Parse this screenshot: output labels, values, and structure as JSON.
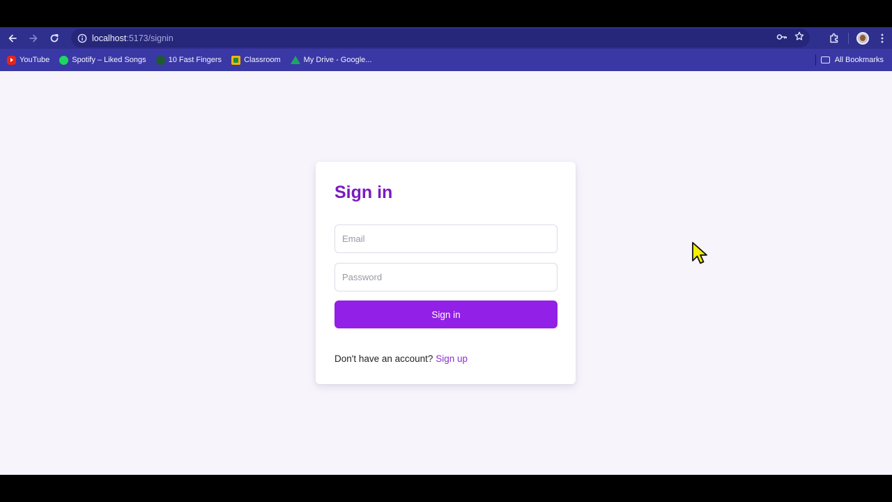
{
  "browser": {
    "url_host": "localhost",
    "url_path": ":5173/signin",
    "bookmarks": [
      {
        "label": "YouTube",
        "icon": "youtube-icon"
      },
      {
        "label": "Spotify – Liked Songs",
        "icon": "spotify-icon"
      },
      {
        "label": "10 Fast Fingers",
        "icon": "10-fast-fingers-icon"
      },
      {
        "label": "Classroom",
        "icon": "classroom-icon"
      },
      {
        "label": "My Drive - Google...",
        "icon": "google-drive-icon"
      }
    ],
    "all_bookmarks_label": "All Bookmarks"
  },
  "signin": {
    "title": "Sign in",
    "email_placeholder": "Email",
    "password_placeholder": "Password",
    "submit_label": "Sign in",
    "signup_prompt": "Don't have an account?",
    "signup_link": "Sign up"
  },
  "colors": {
    "accent": "#9220e6",
    "title": "#7a1bc0",
    "toolbar": "#2f2f8e",
    "bookmarks_bar": "#3a38a5",
    "page_background": "#f7f4fc"
  }
}
